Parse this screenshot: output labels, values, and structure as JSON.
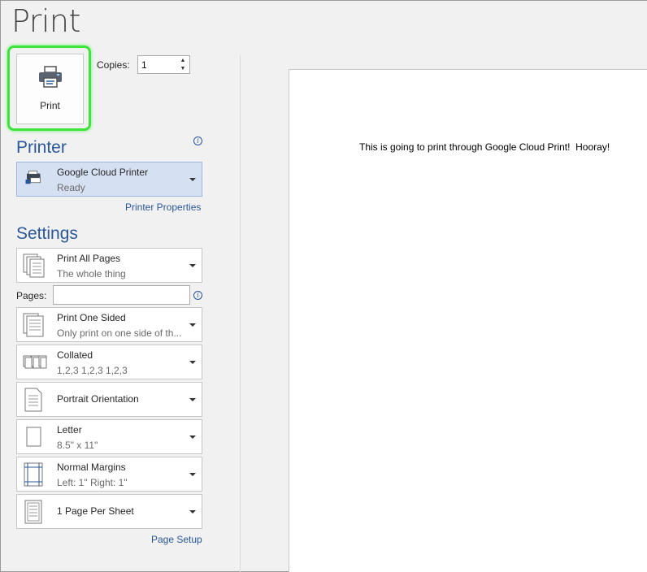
{
  "page": {
    "title": "Print"
  },
  "print_button": {
    "label": "Print",
    "icon": "printer-icon",
    "highlight_color": "#3ce43c"
  },
  "copies": {
    "label": "Copies:",
    "value": "1"
  },
  "printer": {
    "section_title": "Printer",
    "name": "Google Cloud Printer",
    "status": "Ready",
    "properties_link": "Printer Properties"
  },
  "settings": {
    "section_title": "Settings",
    "pages_label": "Pages:",
    "pages_value": "",
    "items": [
      {
        "title": "Print All Pages",
        "subtitle": "The whole thing",
        "icon": "pages-stack-icon"
      },
      {
        "title": "Print One Sided",
        "subtitle": "Only print on one side of th...",
        "icon": "one-sided-icon"
      },
      {
        "title": "Collated",
        "subtitle": "1,2,3    1,2,3    1,2,3",
        "icon": "collated-icon"
      },
      {
        "title": "Portrait Orientation",
        "subtitle": "",
        "icon": "portrait-icon"
      },
      {
        "title": "Letter",
        "subtitle": "8.5\" x 11\"",
        "icon": "paper-size-icon"
      },
      {
        "title": "Normal Margins",
        "subtitle": "Left:  1\"    Right:  1\"",
        "icon": "margins-icon"
      },
      {
        "title": "1 Page Per Sheet",
        "subtitle": "",
        "icon": "pages-per-sheet-icon"
      }
    ],
    "page_setup_link": "Page Setup"
  },
  "preview": {
    "text": "This is going to print through Google Cloud Print!  Hooray!"
  },
  "colors": {
    "accent": "#2b579a",
    "selected_bg": "#d5e1f2",
    "panel_bg": "#f1f1f1"
  }
}
